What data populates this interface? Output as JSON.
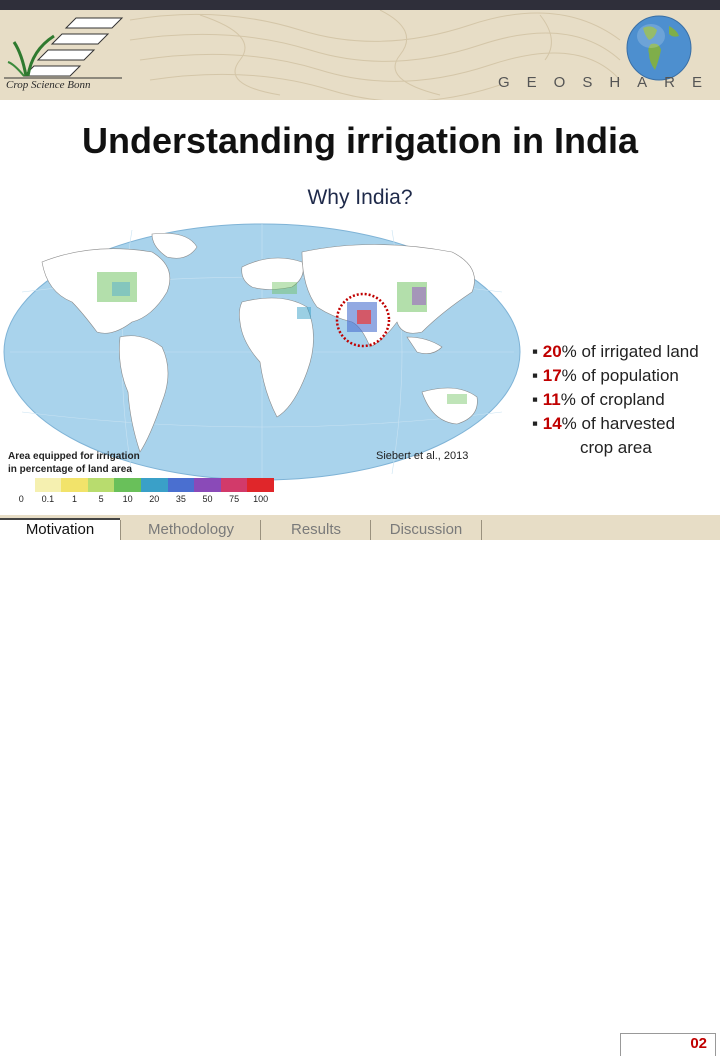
{
  "header": {
    "logo_text": "Crop Science Bonn",
    "brand": "GEOSHARE"
  },
  "slide": {
    "title": "Understanding irrigation in India",
    "subtitle": "Why India?",
    "citation": "Siebert et al., 2013"
  },
  "legend": {
    "title_line1": "Area equipped for irrigation",
    "title_line2": "in percentage of land area",
    "ticks": [
      "0",
      "0.1",
      "1",
      "5",
      "10",
      "20",
      "35",
      "50",
      "75",
      "100"
    ],
    "colors": [
      "#ffffff",
      "#f5f0b0",
      "#f2e36a",
      "#b8dc6e",
      "#69c05a",
      "#3aa0c8",
      "#4a6fd0",
      "#8a4ab8",
      "#d23a6a",
      "#e0262a"
    ]
  },
  "stats": [
    {
      "bullet": "▪",
      "value": "20",
      "text": "% of irrigated land"
    },
    {
      "bullet": "▪",
      "value": "17",
      "text": "% of population"
    },
    {
      "bullet": "▪",
      "value": "11",
      "text": "% of cropland"
    },
    {
      "bullet": "▪",
      "value": "14",
      "text": "% of harvested"
    }
  ],
  "stats_continuation": "crop area",
  "nav": {
    "motivation": "Motivation",
    "methodology": "Methodology",
    "results": "Results",
    "discussion": "Discussion"
  },
  "page_number": "02",
  "colors": {
    "header_bg": "#e7ddc6",
    "accent_red": "#c00000",
    "ocean": "#a9d3ec",
    "land": "#ffffff"
  }
}
